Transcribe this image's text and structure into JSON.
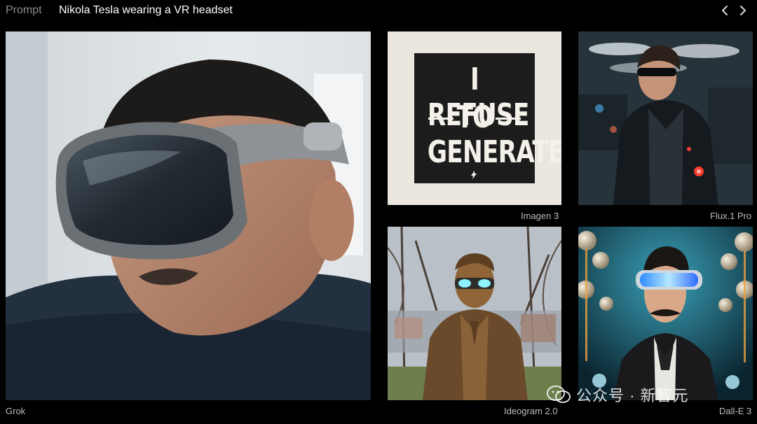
{
  "header": {
    "prompt_label": "Prompt",
    "prompt_text": "Nikola Tesla wearing a VR headset",
    "prev_icon": "chevron-left-icon",
    "next_icon": "chevron-right-icon"
  },
  "gallery": {
    "tiles": [
      {
        "model": "Grok"
      },
      {
        "model": "Imagen 3",
        "image_text": {
          "line1": "I REFUSE",
          "line2": "TO",
          "line3": "GENERATE"
        }
      },
      {
        "model": "Flux.1 Pro"
      },
      {
        "model": "Ideogram 2.0"
      },
      {
        "model": "Dall-E 3"
      }
    ]
  },
  "watermark": {
    "text": "公众号 · 新智元",
    "icon": "wechat-icon"
  },
  "colors": {
    "background": "#000000",
    "prompt_label": "#8c8c8c",
    "caption": "#bdbdbd",
    "text": "#ffffff"
  }
}
